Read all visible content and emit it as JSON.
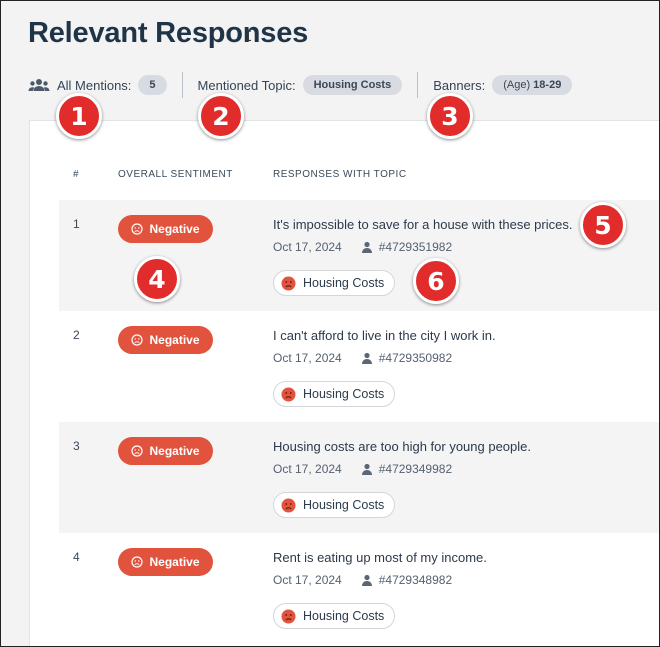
{
  "title": "Relevant Responses",
  "filters": {
    "all_mentions_label": "All Mentions:",
    "all_mentions_count": "5",
    "topic_label": "Mentioned Topic:",
    "topic_value": "Housing Costs",
    "banners_label": "Banners:",
    "banners_prefix": "(Age)",
    "banners_value": "18-29"
  },
  "table": {
    "headers": {
      "num": "#",
      "sentiment": "OVERALL SENTIMENT",
      "responses": "RESPONSES WITH TOPIC"
    },
    "rows": [
      {
        "num": "1",
        "sentiment": "Negative",
        "text": "It's impossible to save for a house with these prices.",
        "date": "Oct 17, 2024",
        "id": "#4729351982",
        "topic": "Housing Costs"
      },
      {
        "num": "2",
        "sentiment": "Negative",
        "text": "I can't afford to live in the city I work in.",
        "date": "Oct 17, 2024",
        "id": "#4729350982",
        "topic": "Housing Costs"
      },
      {
        "num": "3",
        "sentiment": "Negative",
        "text": "Housing costs are too high for young people.",
        "date": "Oct 17, 2024",
        "id": "#4729349982",
        "topic": "Housing Costs"
      },
      {
        "num": "4",
        "sentiment": "Negative",
        "text": "Rent is eating up most of my income.",
        "date": "Oct 17, 2024",
        "id": "#4729348982",
        "topic": "Housing Costs"
      }
    ]
  },
  "markers": [
    "1",
    "2",
    "3",
    "4",
    "5",
    "6"
  ],
  "colors": {
    "negative": "#e2533d",
    "marker": "#e22b2b",
    "pill": "#d8dbe2",
    "title": "#1f3447"
  },
  "icons": {
    "mentions": "users-icon",
    "sentiment": "frown-face-icon",
    "respondent": "person-icon",
    "cursor": "text-cursor-icon"
  }
}
